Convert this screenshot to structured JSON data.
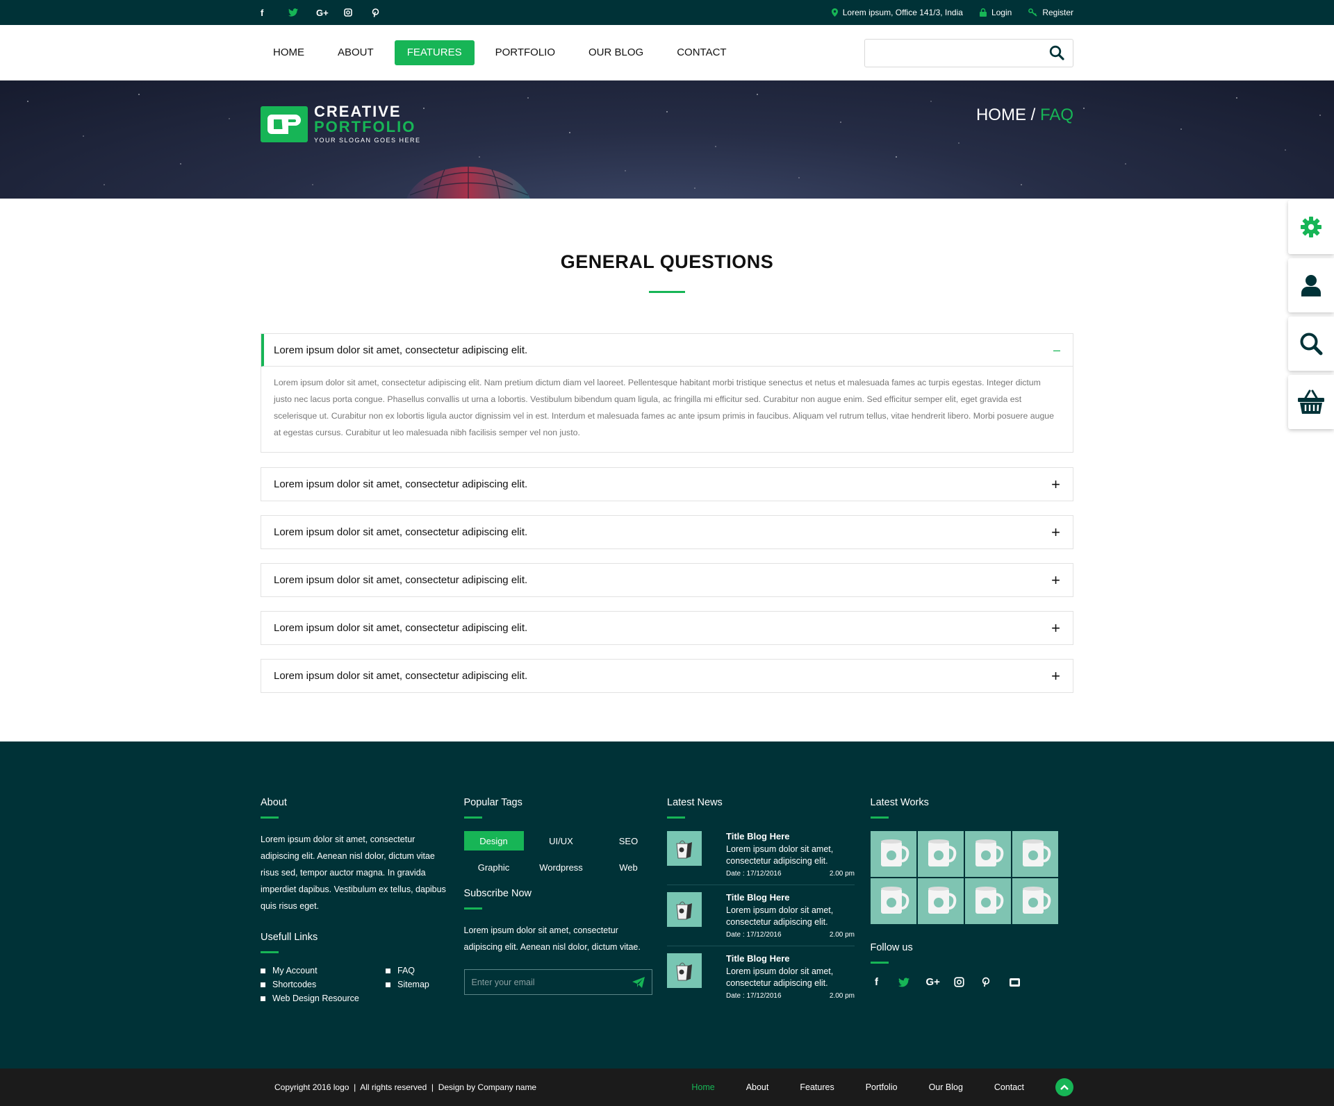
{
  "topbar": {
    "social_icons": [
      "facebook-icon",
      "twitter-icon",
      "google-plus-icon",
      "instagram-icon",
      "pinterest-icon"
    ],
    "address": "Lorem ipsum, Office 141/3, India",
    "login": "Login",
    "register": "Register"
  },
  "nav": {
    "items": [
      "HOME",
      "ABOUT",
      "FEATURES",
      "PORTFOLIO",
      "OUR BLOG",
      "CONTACT"
    ],
    "active": "FEATURES",
    "search_placeholder": ""
  },
  "hero": {
    "logo_line1": "CREATIVE",
    "logo_line2": "PORTFOLIO",
    "logo_slogan": "YOUR SLOGAN GOES HERE",
    "crumb_home": "HOME",
    "crumb_sep": " / ",
    "crumb_current": "FAQ"
  },
  "side_tools": [
    "gear-icon",
    "user-icon",
    "search-icon",
    "basket-icon"
  ],
  "faq": {
    "title": "GENERAL QUESTIONS",
    "items": [
      {
        "question": "Lorem ipsum dolor sit amet, consectetur adipiscing elit.",
        "open": true,
        "toggle": "–",
        "answer": "Lorem ipsum dolor sit amet, consectetur adipiscing elit. Nam pretium dictum diam vel laoreet. Pellentesque habitant morbi tristique senectus et netus et malesuada fames ac turpis egestas. Integer dictum justo nec lacus porta congue. Phasellus convallis ut urna a lobortis. Vestibulum bibendum quam ligula, ac fringilla mi efficitur sed. Curabitur non augue enim. Sed efficitur semper elit, eget gravida est scelerisque ut. Curabitur non ex lobortis ligula auctor dignissim vel in est. Interdum et malesuada fames ac ante ipsum primis in faucibus. Aliquam vel rutrum tellus, vitae hendrerit libero. Morbi posuere augue at egestas cursus. Curabitur ut leo malesuada nibh facilisis semper vel non justo."
      },
      {
        "question": "Lorem ipsum dolor sit amet, consectetur adipiscing elit.",
        "open": false,
        "toggle": "+"
      },
      {
        "question": "Lorem ipsum dolor sit amet, consectetur adipiscing elit.",
        "open": false,
        "toggle": "+"
      },
      {
        "question": "Lorem ipsum dolor sit amet, consectetur adipiscing elit.",
        "open": false,
        "toggle": "+"
      },
      {
        "question": "Lorem ipsum dolor sit amet, consectetur adipiscing elit.",
        "open": false,
        "toggle": "+"
      },
      {
        "question": "Lorem ipsum dolor sit amet, consectetur adipiscing elit.",
        "open": false,
        "toggle": "+"
      }
    ]
  },
  "footer": {
    "about": {
      "title": "About",
      "text": "Lorem ipsum dolor sit amet, consectetur adipiscing elit. Aenean nisl dolor, dictum vitae risus sed, tempor auctor magna. In gravida imperdiet dapibus. Vestibulum ex tellus, dapibus quis risus eget."
    },
    "links": {
      "title": "Usefull Links",
      "items": [
        "My Account",
        "FAQ",
        "Shortcodes",
        "Sitemap",
        "Web Design Resource"
      ]
    },
    "tags": {
      "title": "Popular Tags",
      "items": [
        "Design",
        "UI/UX",
        "SEO",
        "Graphic",
        "Wordpress",
        "Web"
      ],
      "active": "Design"
    },
    "subscribe": {
      "title": "Subscribe Now",
      "text": "Lorem ipsum dolor sit amet, consectetur adipiscing elit. Aenean nisl dolor, dictum vitae.",
      "placeholder": "Enter your email"
    },
    "news": {
      "title": "Latest News",
      "items": [
        {
          "title": "Title Blog Here",
          "desc": "Lorem ipsum dolor sit amet, consectetur adipiscing elit.",
          "date": "Date : 17/12/2016",
          "time": "2.00 pm"
        },
        {
          "title": "Title Blog Here",
          "desc": "Lorem ipsum dolor sit amet, consectetur adipiscing elit.",
          "date": "Date : 17/12/2016",
          "time": "2.00 pm"
        },
        {
          "title": "Title Blog Here",
          "desc": "Lorem ipsum dolor sit amet, consectetur adipiscing elit.",
          "date": "Date : 17/12/2016",
          "time": "2.00 pm"
        }
      ]
    },
    "works": {
      "title": "Latest Works",
      "count": 8
    },
    "follow": {
      "title": "Follow us",
      "icons": [
        "facebook-icon",
        "twitter-icon",
        "google-plus-icon",
        "instagram-icon",
        "pinterest-icon",
        "youtube-icon"
      ]
    }
  },
  "bottom": {
    "copyright": "Copyright 2016 logo  |  All rights reserved  |  Design by Company name",
    "nav": [
      "Home",
      "About",
      "Features",
      "Portfolio",
      "Our Blog",
      "Contact"
    ],
    "active": "Home"
  },
  "colors": {
    "accent": "#17b556",
    "dark": "#003237",
    "bottom": "#1b1b1b"
  }
}
